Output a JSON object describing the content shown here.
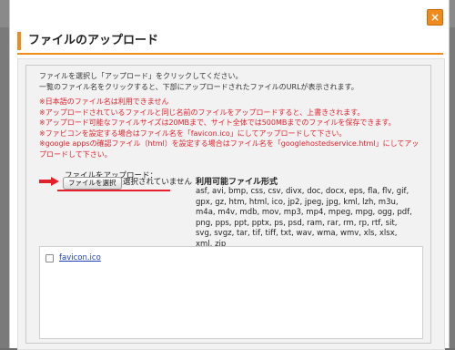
{
  "dialog": {
    "title": "ファイルのアップロード",
    "close_icon": "close-icon"
  },
  "intro": {
    "line1": "ファイルを選択し「アップロード」をクリックしてください。",
    "line2": "一覧のファイル名をクリックすると、下部にアップロードされたファイルのURLが表示されます。"
  },
  "notes": [
    "※日本語のファイル名は利用できません",
    "※アップロードされているファイルと同じ名前のファイルをアップロードすると、上書きされます。",
    "※アップロード可能なファイルサイズは20MBまで、サイト全体では500MBまでのファイルを保存できます。",
    "※ファビコンを設定する場合はファイル名を「favicon.ico」にしてアップロードして下さい。",
    "※google appsの確認ファイル（html）を設定する場合はファイル名を「googlehostedservice.html」にしてアップロードして下さい。"
  ],
  "upload": {
    "label": "ファイルをアップロード：",
    "choose_button": "ファイルを選択",
    "no_file_text": "選択されていません"
  },
  "formats": {
    "title": "利用可能ファイル形式",
    "list": "asf, avi, bmp, css, csv, divx, doc, docx, eps, fla, flv, gif, gpx, gz, htm, html, ico, jp2, jpeg, jpg, kml, lzh, m3u, m4a, m4v, mdb, mov, mp3, mp4, mpeg, mpg, ogg, pdf, png, pps, ppt, pptx, ps, psd, ram, rar, rm, rp, rtf, sit, svg, svgz, tar, tif, tiff, txt, wav, wma, wmv, xls, xlsx, xml, zip"
  },
  "files": [
    {
      "name": "favicon.ico"
    }
  ],
  "colors": {
    "accent": "#f08a1c",
    "warning": "#e6202a",
    "link": "#1a3fbf"
  }
}
